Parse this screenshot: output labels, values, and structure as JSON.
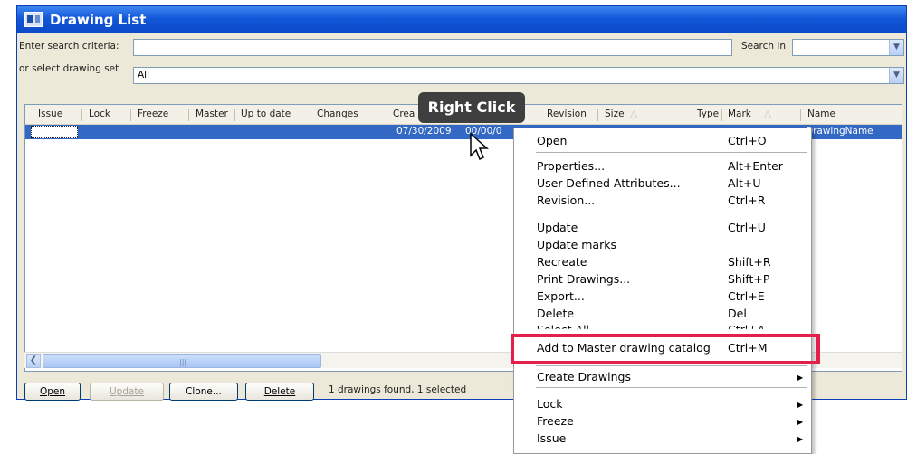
{
  "window": {
    "title": "Drawing List"
  },
  "search": {
    "criteria_label": "Enter search criteria:",
    "criteria_value": "",
    "search_in_label": "Search in",
    "search_in_value": "",
    "set_label": "or select drawing set",
    "set_value": "All"
  },
  "grid": {
    "columns": [
      "Issue",
      "Lock",
      "Freeze",
      "Master",
      "Up to date",
      "Changes",
      "Crea",
      "Revision",
      "Size",
      "Type",
      "Mark",
      "Name"
    ],
    "selected_row": {
      "created": "07/30/2009",
      "modified": "00/00/0",
      "name": "DrawingName"
    }
  },
  "annotation": {
    "badge": "Right Click"
  },
  "buttons": {
    "open": "Open",
    "update": "Update",
    "clone": "Clone...",
    "delete": "Delete"
  },
  "status": "1 drawings found, 1 selected",
  "menu": {
    "items": [
      {
        "label": "Open",
        "shortcut": "Ctrl+O"
      },
      {
        "label": "Properties...",
        "shortcut": "Alt+Enter"
      },
      {
        "label": "User-Defined Attributes...",
        "shortcut": "Alt+U"
      },
      {
        "label": "Revision...",
        "shortcut": "Ctrl+R"
      },
      {
        "label": "Update",
        "shortcut": "Ctrl+U"
      },
      {
        "label": "Update marks",
        "shortcut": ""
      },
      {
        "label": "Recreate",
        "shortcut": "Shift+R"
      },
      {
        "label": "Print Drawings...",
        "shortcut": "Shift+P"
      },
      {
        "label": "Export...",
        "shortcut": "Ctrl+E"
      },
      {
        "label": "Delete",
        "shortcut": "Del"
      },
      {
        "label": "Select All",
        "shortcut": "Ctrl+A"
      },
      {
        "label": "Add to Master drawing catalog",
        "shortcut": "Ctrl+M"
      },
      {
        "label": "Create Drawings",
        "shortcut": ""
      },
      {
        "label": "Lock",
        "shortcut": ""
      },
      {
        "label": "Freeze",
        "shortcut": ""
      },
      {
        "label": "Issue",
        "shortcut": ""
      }
    ],
    "highlight_color": "#e41f4a"
  },
  "colors": {
    "selection": "#3368c4",
    "titlebar": "#0c49c7"
  }
}
